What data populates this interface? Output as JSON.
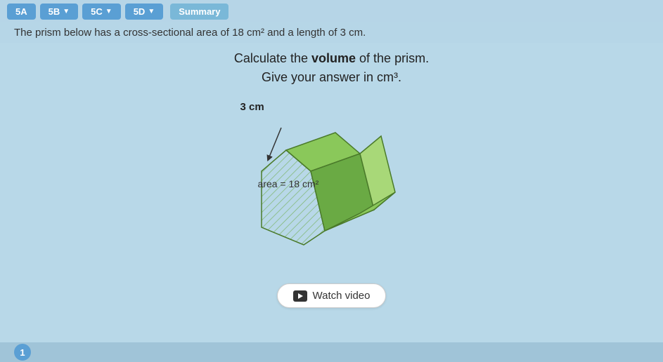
{
  "nav": {
    "btn_5a": "5A",
    "btn_5b": "5B",
    "btn_5c": "5C",
    "btn_5d": "5D",
    "btn_summary": "Summary"
  },
  "header": {
    "text": "The prism below has a cross-sectional area of 18 cm² and a length of 3 cm."
  },
  "question": {
    "line1_prefix": "Calculate the ",
    "line1_bold": "volume",
    "line1_suffix": " of the prism.",
    "line2": "Give your answer in cm³."
  },
  "diagram": {
    "length_label": "3 cm",
    "area_label": "area = 18 cm²"
  },
  "watch_video": {
    "label": "Watch video"
  },
  "bottom": {
    "page_number": "1"
  }
}
